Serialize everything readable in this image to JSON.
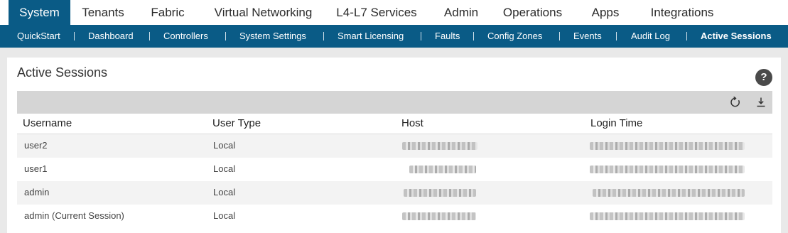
{
  "top_nav": {
    "tabs": [
      {
        "label": "System",
        "active": true
      },
      {
        "label": "Tenants",
        "active": false
      },
      {
        "label": "Fabric",
        "active": false
      },
      {
        "label": "Virtual Networking",
        "active": false
      },
      {
        "label": "L4-L7 Services",
        "active": false
      },
      {
        "label": "Admin",
        "active": false
      },
      {
        "label": "Operations",
        "active": false
      },
      {
        "label": "Apps",
        "active": false
      },
      {
        "label": "Integrations",
        "active": false
      }
    ]
  },
  "sub_nav": {
    "tabs": [
      {
        "label": "QuickStart",
        "active": false
      },
      {
        "label": "Dashboard",
        "active": false
      },
      {
        "label": "Controllers",
        "active": false
      },
      {
        "label": "System Settings",
        "active": false
      },
      {
        "label": "Smart Licensing",
        "active": false
      },
      {
        "label": "Faults",
        "active": false
      },
      {
        "label": "Config Zones",
        "active": false
      },
      {
        "label": "Events",
        "active": false
      },
      {
        "label": "Audit Log",
        "active": false
      },
      {
        "label": "Active Sessions",
        "active": true
      }
    ]
  },
  "panel": {
    "title": "Active Sessions",
    "help_label": "?"
  },
  "toolbar": {
    "icons": [
      "refresh-icon",
      "download-icon"
    ]
  },
  "table": {
    "columns": [
      "Username",
      "User Type",
      "Host",
      "Login Time"
    ],
    "rows": [
      {
        "username": "user2",
        "user_type": "Local",
        "host_redacted": true,
        "login_time_redacted": true
      },
      {
        "username": "user1",
        "user_type": "Local",
        "host_redacted": true,
        "login_time_redacted": true
      },
      {
        "username": "admin",
        "user_type": "Local",
        "host_redacted": true,
        "login_time_redacted": true
      },
      {
        "username": "admin (Current Session)",
        "user_type": "Local",
        "host_redacted": true,
        "login_time_redacted": true
      }
    ]
  },
  "colors": {
    "nav_blue": "#0a5b86",
    "toolbar_gray": "#d5d5d5",
    "page_background": "#e9e9e9"
  }
}
